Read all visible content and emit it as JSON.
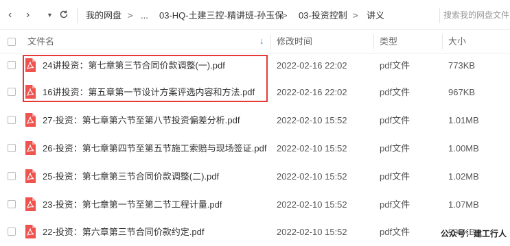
{
  "nav": {
    "crumbs": [
      "我的网盘",
      "...",
      "03-HQ-土建三控-精讲班-孙玉保",
      "03-投资控制",
      "讲义"
    ],
    "search_placeholder": "搜索我的网盘文件"
  },
  "columns": {
    "name": "文件名",
    "modified": "修改时间",
    "type": "类型",
    "size": "大小"
  },
  "files": [
    {
      "name": "24讲投资：第七章第三节合同价款调整(一).pdf",
      "modified": "2022-02-16 22:02",
      "type": "pdf文件",
      "size": "773KB"
    },
    {
      "name": "16讲投资：第五章第一节设计方案评选内容和方法.pdf",
      "modified": "2022-02-16 22:02",
      "type": "pdf文件",
      "size": "967KB"
    },
    {
      "name": "27-投资：第七章第六节至第八节投资偏差分析.pdf",
      "modified": "2022-02-10 15:52",
      "type": "pdf文件",
      "size": "1.01MB"
    },
    {
      "name": "26-投资：第七章第四节至第五节施工索赔与现场签证.pdf",
      "modified": "2022-02-10 15:52",
      "type": "pdf文件",
      "size": "1.00MB"
    },
    {
      "name": "25-投资：第七章第三节合同价款调整(二).pdf",
      "modified": "2022-02-10 15:52",
      "type": "pdf文件",
      "size": "1.02MB"
    },
    {
      "name": "23-投资：第七章第一节至第二节工程计量.pdf",
      "modified": "2022-02-10 15:52",
      "type": "pdf文件",
      "size": "1.07MB"
    },
    {
      "name": "22-投资：第六章第三节合同价款约定.pdf",
      "modified": "2022-02-10 15:52",
      "type": "pdf文件",
      "size": "995KB"
    }
  ],
  "watermark": "公众号：建工行人",
  "colors": {
    "accent": "#1e88e5",
    "pdf_icon": "#ef5350",
    "highlight": "#e53935"
  }
}
